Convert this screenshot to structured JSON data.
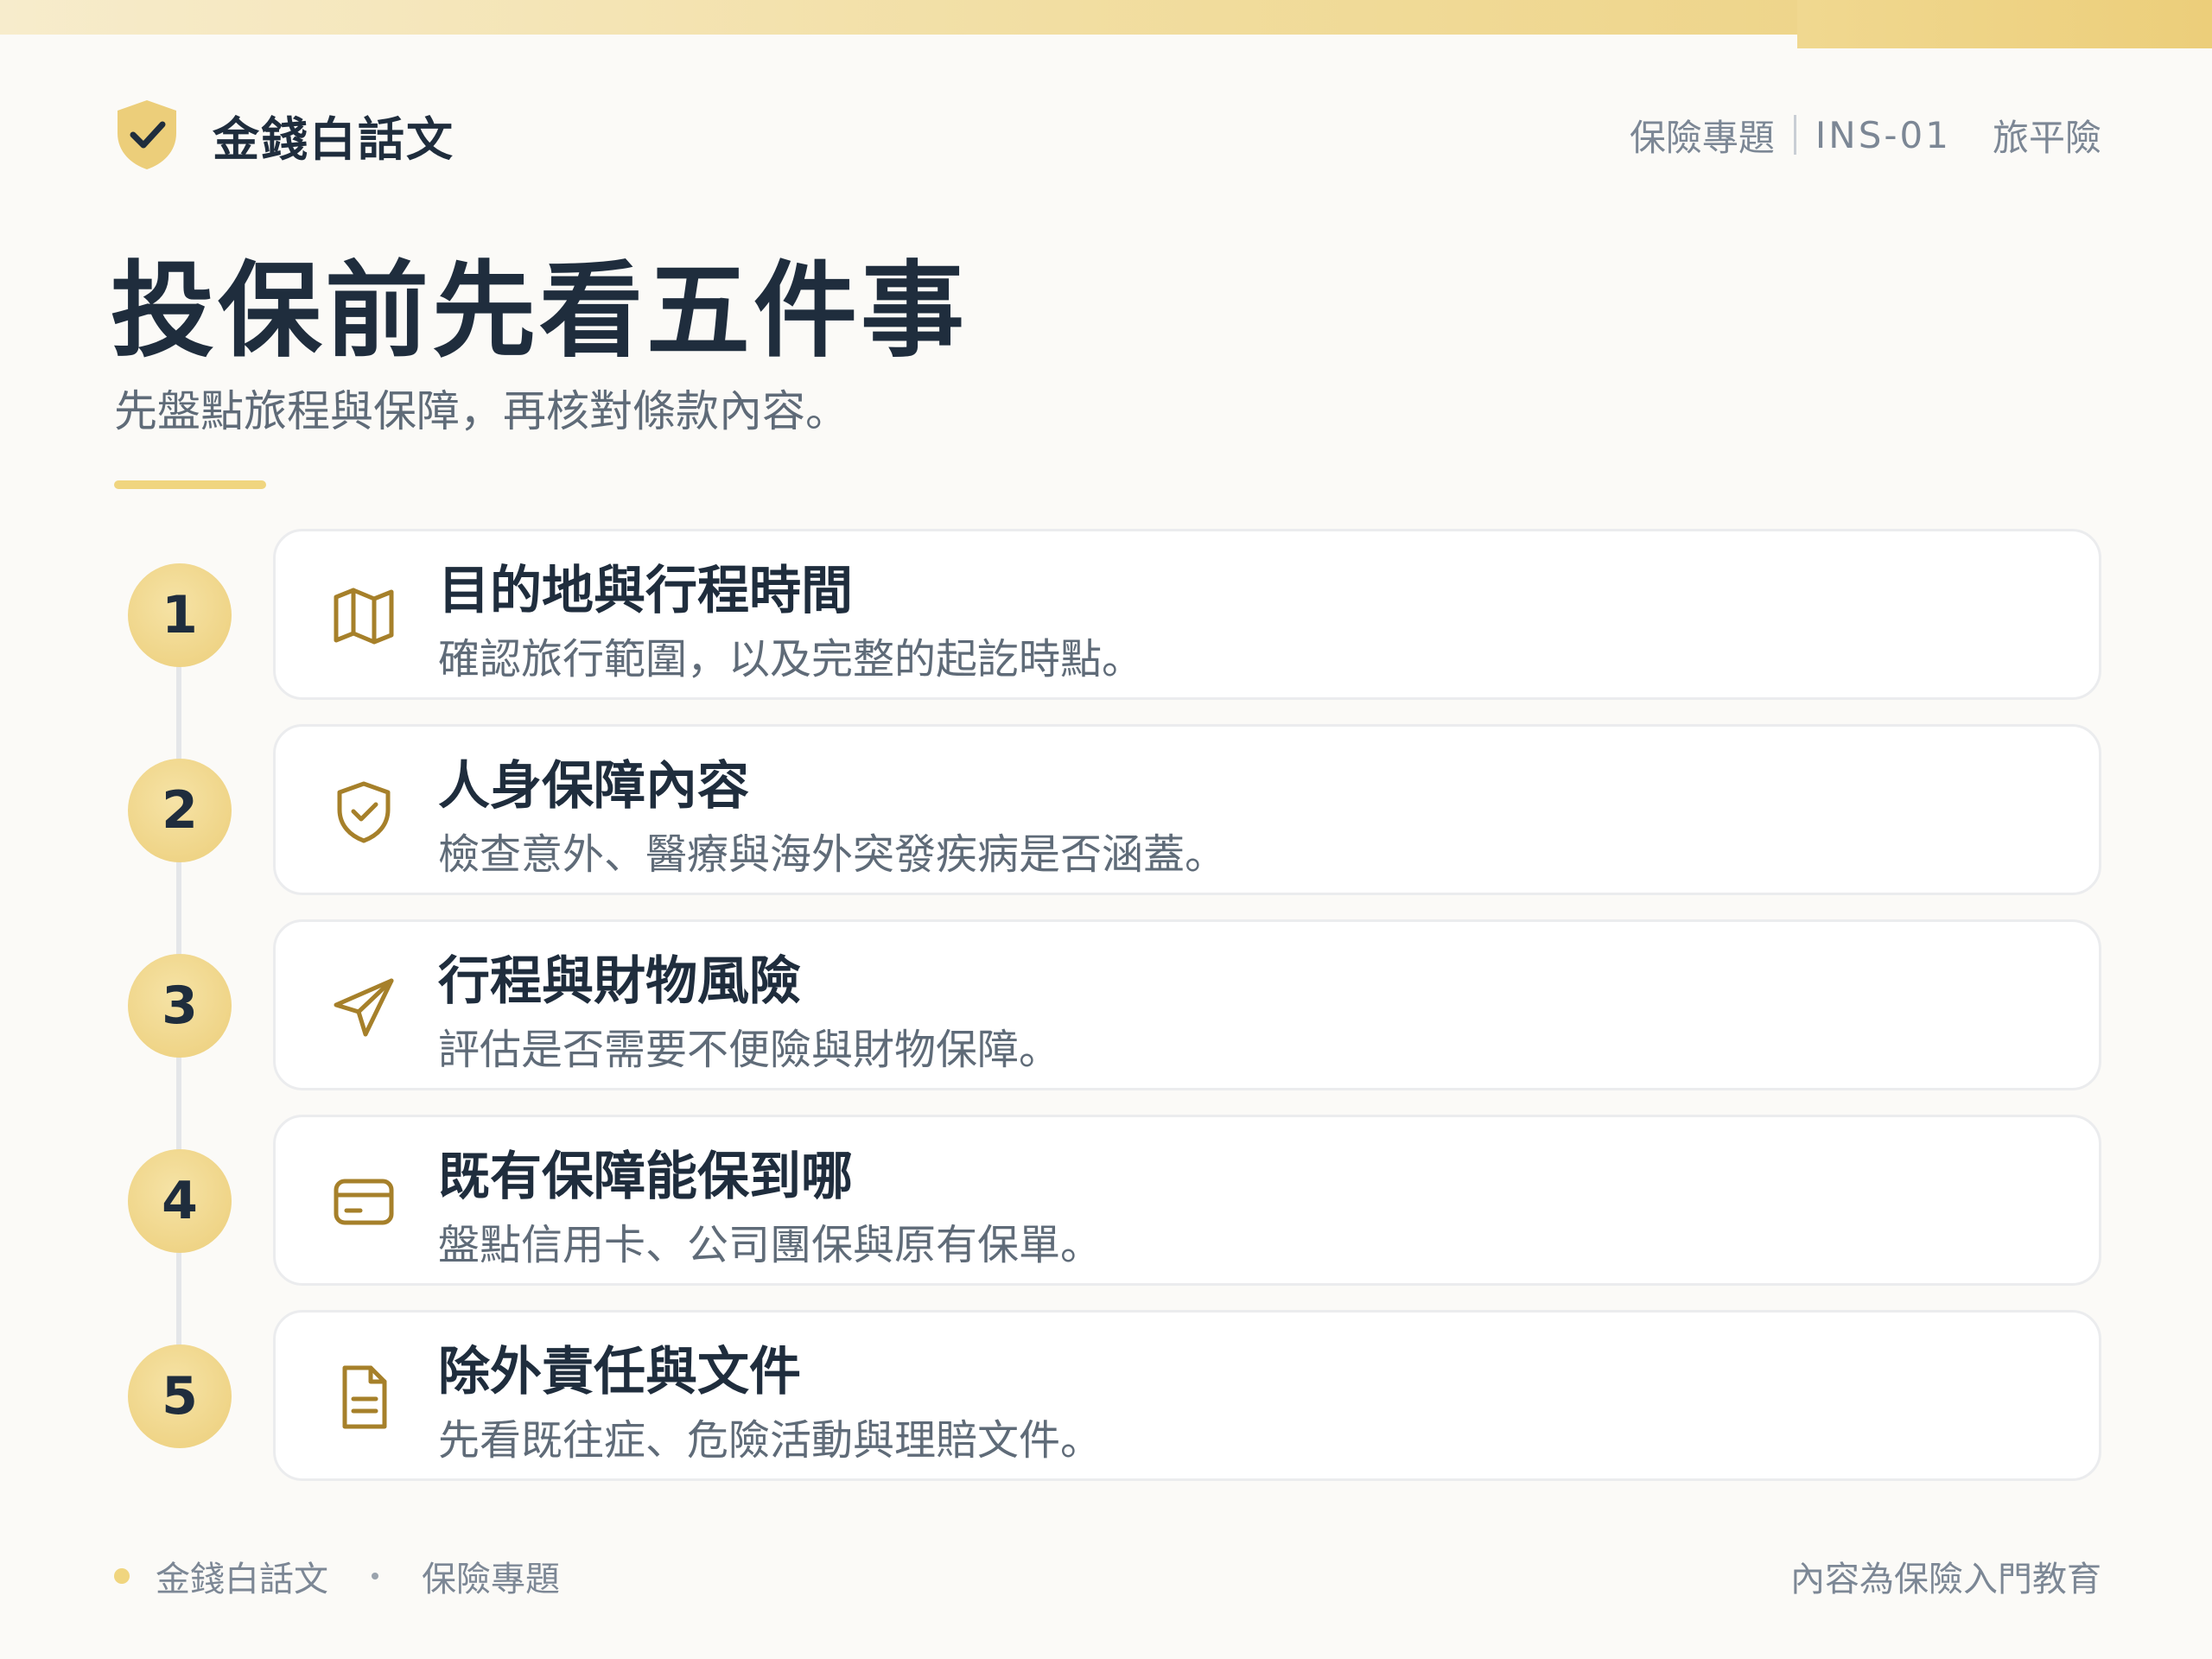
{
  "brand": {
    "name": "金錢白話文"
  },
  "meta": {
    "topic": "保險專題",
    "code": "INS-01",
    "type": "旅平險"
  },
  "title": "投保前先看五件事",
  "subtitle": "先盤點旅程與保障，再核對條款內容。",
  "steps": [
    {
      "number": "1",
      "icon": "map-icon",
      "title": "目的地與行程時間",
      "desc": "確認旅行範圍，以及完整的起訖時點。"
    },
    {
      "number": "2",
      "icon": "shield-check-icon",
      "title": "人身保障內容",
      "desc": "檢查意外、醫療與海外突發疾病是否涵蓋。"
    },
    {
      "number": "3",
      "icon": "send-icon",
      "title": "行程與財物風險",
      "desc": "評估是否需要不便險與財物保障。"
    },
    {
      "number": "4",
      "icon": "credit-card-icon",
      "title": "既有保障能保到哪",
      "desc": "盤點信用卡、公司團保與原有保單。"
    },
    {
      "number": "5",
      "icon": "document-icon",
      "title": "除外責任與文件",
      "desc": "先看既往症、危險活動與理賠文件。"
    }
  ],
  "footer": {
    "brand": "金錢白話文",
    "topic": "保險專題",
    "note": "內容為保險入門教育"
  },
  "colors": {
    "accent": "#ecce7a",
    "icon": "#a6802a",
    "text": "#1f2d3d",
    "muted": "#5f6b78"
  }
}
